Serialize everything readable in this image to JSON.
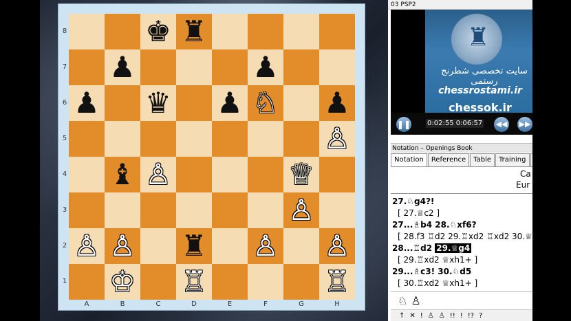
{
  "board": {
    "ranks": [
      "8",
      "7",
      "6",
      "5",
      "4",
      "3",
      "2",
      "1"
    ],
    "files": [
      "A",
      "B",
      "C",
      "D",
      "E",
      "F",
      "G",
      "H"
    ],
    "rows": [
      [
        "",
        "",
        "♚",
        "♜",
        "",
        "",
        "",
        ""
      ],
      [
        "",
        "♟",
        "",
        "",
        "",
        "♟",
        "",
        ""
      ],
      [
        "♟",
        "",
        "♛",
        "",
        "♟",
        "♘",
        "",
        "♟"
      ],
      [
        "",
        "",
        "",
        "",
        "",
        "",
        "",
        "♙"
      ],
      [
        "",
        "♝",
        "♙",
        "",
        "",
        "",
        "♕",
        ""
      ],
      [
        "",
        "",
        "",
        "",
        "",
        "",
        "♙",
        ""
      ],
      [
        "♙",
        "♙",
        "",
        "♜",
        "",
        "♙",
        "",
        "♙"
      ],
      [
        "",
        "♔",
        "",
        "♖",
        "",
        "",
        "",
        "♖"
      ]
    ],
    "colors": {
      "light": "#f6dcb2",
      "dark": "#e38c2a"
    }
  },
  "video": {
    "title": "03 PSP2",
    "farsi": "سایت تخصصی شطرنج رستمی",
    "site1": "chessrostami.ir",
    "site2": "chessok.ir",
    "timer": "0:02:55 0:06:57",
    "pause": "❚❚",
    "rewind": "◀◀",
    "forward": "▶▶",
    "logo": "♜"
  },
  "notation": {
    "title": "Notation – Openings Book",
    "tabs": [
      "Notation",
      "Reference",
      "Table",
      "Training",
      "S"
    ],
    "header1": "Ca",
    "header2": "Eur",
    "lines": [
      {
        "type": "main",
        "text": "27.♘g4?!"
      },
      {
        "type": "var",
        "text": "[ 27.♕c2 ]"
      },
      {
        "type": "main",
        "text": "27...♗b4  28.♘xf6?"
      },
      {
        "type": "var",
        "text": "[ 28.f3  ♖d2  29.♖xd2  ♖xd2  30.♕"
      },
      {
        "type": "main",
        "text": "28...♖d2 ",
        "hl": "29.♕g4"
      },
      {
        "type": "var",
        "text": "[ 29.♖xd2  ♕xh1+ ]"
      },
      {
        "type": "main",
        "text": "29...♗c3!  30.♘d5"
      },
      {
        "type": "var",
        "text": "[ 30.♖xd2  ♕xh1+ ]"
      }
    ],
    "piece_icons": "♘  ♙",
    "symbols": [
      "↑",
      "✕",
      "!",
      "♙",
      "♙",
      "!!",
      "!",
      "!?",
      "?"
    ]
  }
}
